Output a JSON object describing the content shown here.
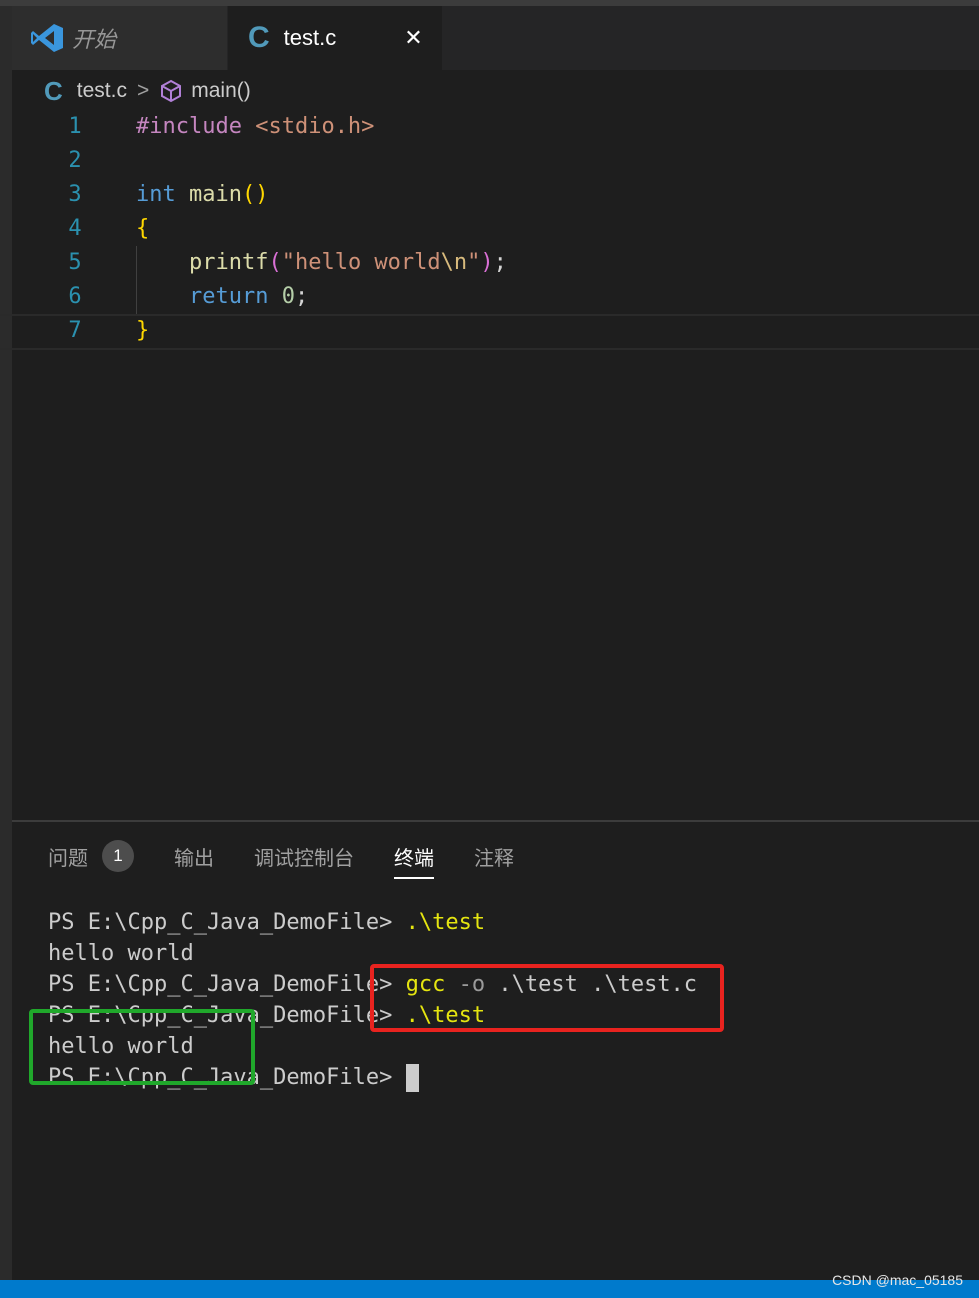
{
  "tabs": [
    {
      "label": "开始",
      "icon": "vscode-logo-icon"
    },
    {
      "label": "test.c",
      "icon": "c-file-icon",
      "close": "✕"
    }
  ],
  "breadcrumb": {
    "file": "test.c",
    "separator": ">",
    "symbol": "main()"
  },
  "editor": {
    "line_numbers": [
      "1",
      "2",
      "3",
      "4",
      "5",
      "6",
      "7"
    ],
    "line1": {
      "directive": "#include",
      "header": "<stdio.h>"
    },
    "line3": {
      "type": "int",
      "name": "main",
      "open": "(",
      "close": ")"
    },
    "line4": {
      "brace": "{"
    },
    "line5": {
      "fn": "printf",
      "open": "(",
      "str_a": "\"hello world",
      "esc": "\\n",
      "str_b": "\"",
      "close": ")",
      "semi": ";"
    },
    "line6": {
      "kw": "return",
      "num": "0",
      "semi": ";"
    },
    "line7": {
      "brace": "}"
    }
  },
  "panel": {
    "tabs": [
      "问题",
      "输出",
      "调试控制台",
      "终端",
      "注释"
    ],
    "problems_count": "1",
    "active_tab": "终端"
  },
  "terminal": {
    "prompt": "PS E:\\Cpp_C_Java_DemoFile>",
    "cmd_run": ".\\test",
    "output": "hello world",
    "cmd_gcc": "gcc",
    "cmd_opt": "-o",
    "cmd_args": ".\\test .\\test.c"
  },
  "watermark": "CSDN @mac_05185",
  "colors": {
    "accent": "#007acc",
    "red_box": "#e8231f",
    "green_box": "#20a82b"
  }
}
